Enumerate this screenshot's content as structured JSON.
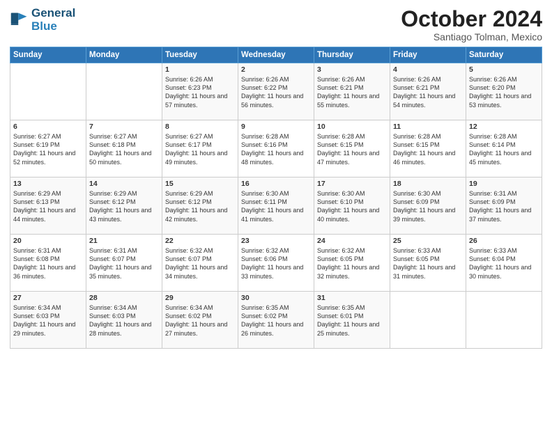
{
  "logo": {
    "line1": "General",
    "line2": "Blue"
  },
  "header": {
    "month": "October 2024",
    "location": "Santiago Tolman, Mexico"
  },
  "days_of_week": [
    "Sunday",
    "Monday",
    "Tuesday",
    "Wednesday",
    "Thursday",
    "Friday",
    "Saturday"
  ],
  "weeks": [
    [
      {
        "day": "",
        "sunrise": "",
        "sunset": "",
        "daylight": ""
      },
      {
        "day": "",
        "sunrise": "",
        "sunset": "",
        "daylight": ""
      },
      {
        "day": "1",
        "sunrise": "Sunrise: 6:26 AM",
        "sunset": "Sunset: 6:23 PM",
        "daylight": "Daylight: 11 hours and 57 minutes."
      },
      {
        "day": "2",
        "sunrise": "Sunrise: 6:26 AM",
        "sunset": "Sunset: 6:22 PM",
        "daylight": "Daylight: 11 hours and 56 minutes."
      },
      {
        "day": "3",
        "sunrise": "Sunrise: 6:26 AM",
        "sunset": "Sunset: 6:21 PM",
        "daylight": "Daylight: 11 hours and 55 minutes."
      },
      {
        "day": "4",
        "sunrise": "Sunrise: 6:26 AM",
        "sunset": "Sunset: 6:21 PM",
        "daylight": "Daylight: 11 hours and 54 minutes."
      },
      {
        "day": "5",
        "sunrise": "Sunrise: 6:26 AM",
        "sunset": "Sunset: 6:20 PM",
        "daylight": "Daylight: 11 hours and 53 minutes."
      }
    ],
    [
      {
        "day": "6",
        "sunrise": "Sunrise: 6:27 AM",
        "sunset": "Sunset: 6:19 PM",
        "daylight": "Daylight: 11 hours and 52 minutes."
      },
      {
        "day": "7",
        "sunrise": "Sunrise: 6:27 AM",
        "sunset": "Sunset: 6:18 PM",
        "daylight": "Daylight: 11 hours and 50 minutes."
      },
      {
        "day": "8",
        "sunrise": "Sunrise: 6:27 AM",
        "sunset": "Sunset: 6:17 PM",
        "daylight": "Daylight: 11 hours and 49 minutes."
      },
      {
        "day": "9",
        "sunrise": "Sunrise: 6:28 AM",
        "sunset": "Sunset: 6:16 PM",
        "daylight": "Daylight: 11 hours and 48 minutes."
      },
      {
        "day": "10",
        "sunrise": "Sunrise: 6:28 AM",
        "sunset": "Sunset: 6:15 PM",
        "daylight": "Daylight: 11 hours and 47 minutes."
      },
      {
        "day": "11",
        "sunrise": "Sunrise: 6:28 AM",
        "sunset": "Sunset: 6:15 PM",
        "daylight": "Daylight: 11 hours and 46 minutes."
      },
      {
        "day": "12",
        "sunrise": "Sunrise: 6:28 AM",
        "sunset": "Sunset: 6:14 PM",
        "daylight": "Daylight: 11 hours and 45 minutes."
      }
    ],
    [
      {
        "day": "13",
        "sunrise": "Sunrise: 6:29 AM",
        "sunset": "Sunset: 6:13 PM",
        "daylight": "Daylight: 11 hours and 44 minutes."
      },
      {
        "day": "14",
        "sunrise": "Sunrise: 6:29 AM",
        "sunset": "Sunset: 6:12 PM",
        "daylight": "Daylight: 11 hours and 43 minutes."
      },
      {
        "day": "15",
        "sunrise": "Sunrise: 6:29 AM",
        "sunset": "Sunset: 6:12 PM",
        "daylight": "Daylight: 11 hours and 42 minutes."
      },
      {
        "day": "16",
        "sunrise": "Sunrise: 6:30 AM",
        "sunset": "Sunset: 6:11 PM",
        "daylight": "Daylight: 11 hours and 41 minutes."
      },
      {
        "day": "17",
        "sunrise": "Sunrise: 6:30 AM",
        "sunset": "Sunset: 6:10 PM",
        "daylight": "Daylight: 11 hours and 40 minutes."
      },
      {
        "day": "18",
        "sunrise": "Sunrise: 6:30 AM",
        "sunset": "Sunset: 6:09 PM",
        "daylight": "Daylight: 11 hours and 39 minutes."
      },
      {
        "day": "19",
        "sunrise": "Sunrise: 6:31 AM",
        "sunset": "Sunset: 6:09 PM",
        "daylight": "Daylight: 11 hours and 37 minutes."
      }
    ],
    [
      {
        "day": "20",
        "sunrise": "Sunrise: 6:31 AM",
        "sunset": "Sunset: 6:08 PM",
        "daylight": "Daylight: 11 hours and 36 minutes."
      },
      {
        "day": "21",
        "sunrise": "Sunrise: 6:31 AM",
        "sunset": "Sunset: 6:07 PM",
        "daylight": "Daylight: 11 hours and 35 minutes."
      },
      {
        "day": "22",
        "sunrise": "Sunrise: 6:32 AM",
        "sunset": "Sunset: 6:07 PM",
        "daylight": "Daylight: 11 hours and 34 minutes."
      },
      {
        "day": "23",
        "sunrise": "Sunrise: 6:32 AM",
        "sunset": "Sunset: 6:06 PM",
        "daylight": "Daylight: 11 hours and 33 minutes."
      },
      {
        "day": "24",
        "sunrise": "Sunrise: 6:32 AM",
        "sunset": "Sunset: 6:05 PM",
        "daylight": "Daylight: 11 hours and 32 minutes."
      },
      {
        "day": "25",
        "sunrise": "Sunrise: 6:33 AM",
        "sunset": "Sunset: 6:05 PM",
        "daylight": "Daylight: 11 hours and 31 minutes."
      },
      {
        "day": "26",
        "sunrise": "Sunrise: 6:33 AM",
        "sunset": "Sunset: 6:04 PM",
        "daylight": "Daylight: 11 hours and 30 minutes."
      }
    ],
    [
      {
        "day": "27",
        "sunrise": "Sunrise: 6:34 AM",
        "sunset": "Sunset: 6:03 PM",
        "daylight": "Daylight: 11 hours and 29 minutes."
      },
      {
        "day": "28",
        "sunrise": "Sunrise: 6:34 AM",
        "sunset": "Sunset: 6:03 PM",
        "daylight": "Daylight: 11 hours and 28 minutes."
      },
      {
        "day": "29",
        "sunrise": "Sunrise: 6:34 AM",
        "sunset": "Sunset: 6:02 PM",
        "daylight": "Daylight: 11 hours and 27 minutes."
      },
      {
        "day": "30",
        "sunrise": "Sunrise: 6:35 AM",
        "sunset": "Sunset: 6:02 PM",
        "daylight": "Daylight: 11 hours and 26 minutes."
      },
      {
        "day": "31",
        "sunrise": "Sunrise: 6:35 AM",
        "sunset": "Sunset: 6:01 PM",
        "daylight": "Daylight: 11 hours and 25 minutes."
      },
      {
        "day": "",
        "sunrise": "",
        "sunset": "",
        "daylight": ""
      },
      {
        "day": "",
        "sunrise": "",
        "sunset": "",
        "daylight": ""
      }
    ]
  ]
}
